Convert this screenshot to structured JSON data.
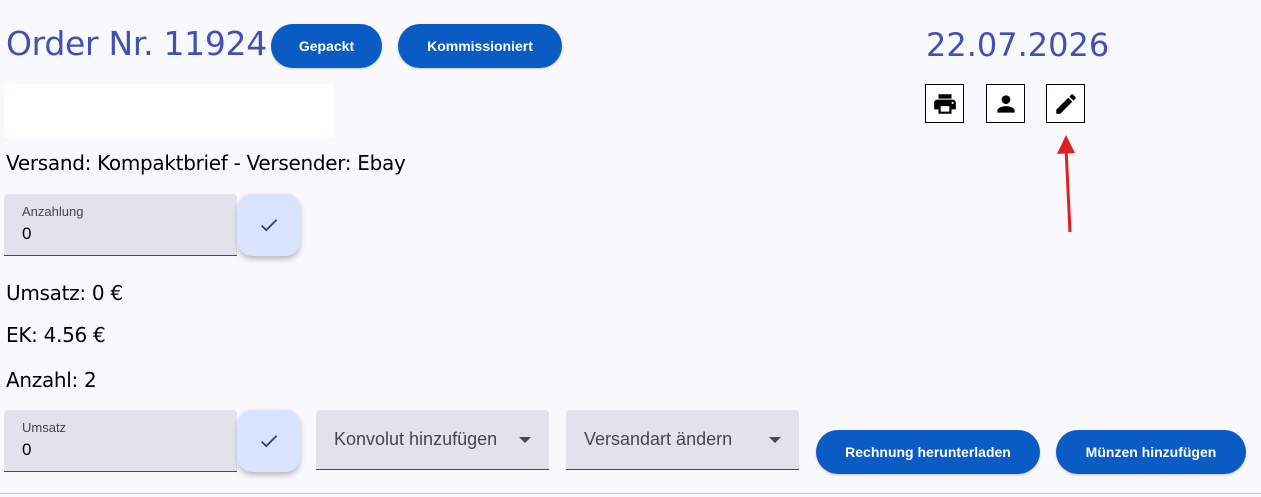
{
  "header": {
    "order_title": "Order Nr. 11924",
    "packed_label": "Gepackt",
    "picked_label": "Kommissioniert",
    "date": "22.07.2026"
  },
  "toolbar": {
    "print_icon": "print-icon",
    "person_icon": "person-icon",
    "edit_icon": "edit-icon"
  },
  "info": {
    "shipping": "Versand: Kompaktbrief - Versender: Ebay",
    "revenue": "Umsatz: 0 €",
    "ek": "EK: 4.56 €",
    "count": "Anzahl: 2"
  },
  "deposit_field": {
    "label": "Anzahlung",
    "value": "0"
  },
  "revenue_field": {
    "label": "Umsatz",
    "value": "0"
  },
  "selects": {
    "lot": "Konvolut hinzufügen",
    "shipping_type": "Versandart ändern"
  },
  "actions": {
    "download_invoice": "Rechnung herunterladen",
    "add_coins": "Münzen hinzufügen"
  },
  "colors": {
    "primary": "#0a5bc4",
    "title": "#3f51b5",
    "annotation_arrow": "#e02020"
  }
}
